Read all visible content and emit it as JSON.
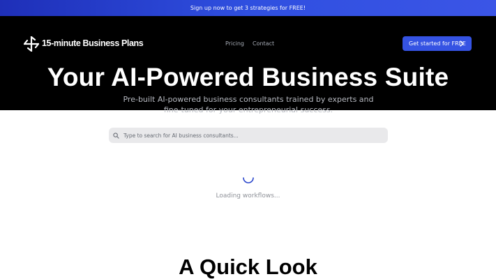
{
  "announcement": {
    "text": "Sign up now to get 3 strategies for FREE!"
  },
  "header": {
    "brand": "15-minute Business Plans",
    "logo_icon": "pinwheel-logo-icon",
    "nav": [
      {
        "label": "Pricing"
      },
      {
        "label": "Contact"
      }
    ],
    "cta_label": "Get started for FREE",
    "cta_icon": "chevron-right-icon"
  },
  "hero": {
    "title": "Your AI-Powered Business Suite",
    "subtitle": "Pre-built AI-powered business consultants trained by experts and fine-tuned for your entrepreneurial success."
  },
  "search": {
    "placeholder": "Type to search for AI business consultants...",
    "value": "",
    "icon": "search-icon"
  },
  "status": {
    "loading_text": "Loading workflows..."
  },
  "section": {
    "title": "A Quick Look"
  },
  "colors": {
    "accent": "#3553e3",
    "banner": "#2f4fe0",
    "hero_bg": "#000000",
    "search_bg": "#e9e9eb",
    "spinner": "#2a46cc"
  }
}
